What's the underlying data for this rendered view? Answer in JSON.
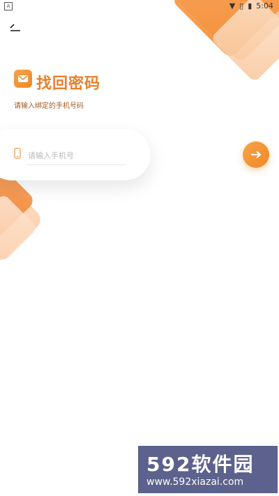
{
  "status_bar": {
    "time": "5:04",
    "app_icon": "A",
    "icons": [
      "wifi-icon",
      "no-sim-icon",
      "battery-icon"
    ]
  },
  "header": {
    "back_icon": "back-arrow-icon"
  },
  "page": {
    "logo_icon": "mail-logo-icon",
    "title": "找回密码",
    "subtitle": "请输入绑定的手机号码"
  },
  "form": {
    "phone_placeholder": "请输入手机号",
    "phone_value": "",
    "phone_icon": "phone-icon",
    "next_icon": "arrow-right-icon"
  },
  "watermark": {
    "main": "592软件园",
    "sub": "www.592xiazai.com"
  },
  "colors": {
    "accent": "#f08a24",
    "title": "#e8802a",
    "subtitle": "#a25b22",
    "watermark_bg": "#5c628d"
  }
}
